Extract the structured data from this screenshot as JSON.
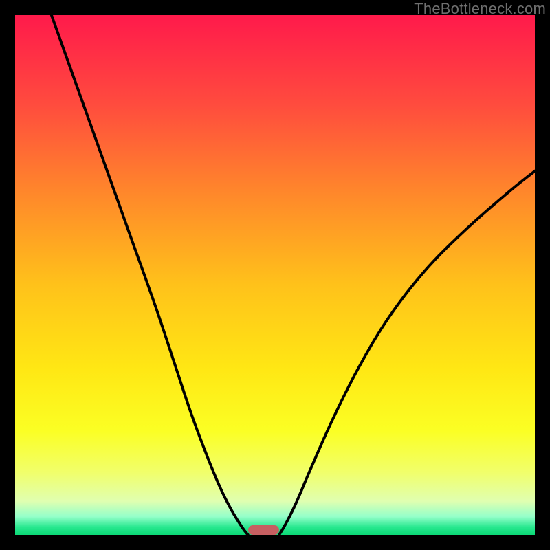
{
  "watermark": "TheBottleneck.com",
  "colors": {
    "frame": "#000000",
    "gradient_stops": [
      {
        "pos": 0.0,
        "color": "#ff1a4b"
      },
      {
        "pos": 0.17,
        "color": "#ff4b3e"
      },
      {
        "pos": 0.35,
        "color": "#ff8a2a"
      },
      {
        "pos": 0.52,
        "color": "#ffc21a"
      },
      {
        "pos": 0.68,
        "color": "#ffe714"
      },
      {
        "pos": 0.8,
        "color": "#fbff24"
      },
      {
        "pos": 0.88,
        "color": "#f1ff6b"
      },
      {
        "pos": 0.935,
        "color": "#e0ffb0"
      },
      {
        "pos": 0.965,
        "color": "#94ffca"
      },
      {
        "pos": 0.985,
        "color": "#28e88f"
      },
      {
        "pos": 1.0,
        "color": "#0cd977"
      }
    ],
    "curve": "#000000",
    "plateau": "#c65f61"
  },
  "chart_data": {
    "type": "line",
    "title": "",
    "xlabel": "",
    "ylabel": "",
    "xlim": [
      0,
      100
    ],
    "ylim": [
      0,
      100
    ],
    "series": [
      {
        "name": "left-curve",
        "x": [
          7,
          12,
          17,
          22,
          27,
          31,
          34,
          37,
          39.5,
          41.5,
          43,
          44,
          44.8
        ],
        "y": [
          100,
          86,
          72,
          58,
          44,
          32,
          23,
          15,
          9,
          5,
          2.5,
          1,
          0
        ]
      },
      {
        "name": "right-curve",
        "x": [
          50.8,
          52,
          54,
          57,
          61,
          66,
          72,
          79,
          87,
          95,
          100
        ],
        "y": [
          0,
          2,
          6,
          13,
          22,
          32,
          42,
          51,
          59,
          66,
          70
        ]
      }
    ],
    "plateau": {
      "x_start": 44.8,
      "x_end": 50.8,
      "y": 0
    }
  }
}
